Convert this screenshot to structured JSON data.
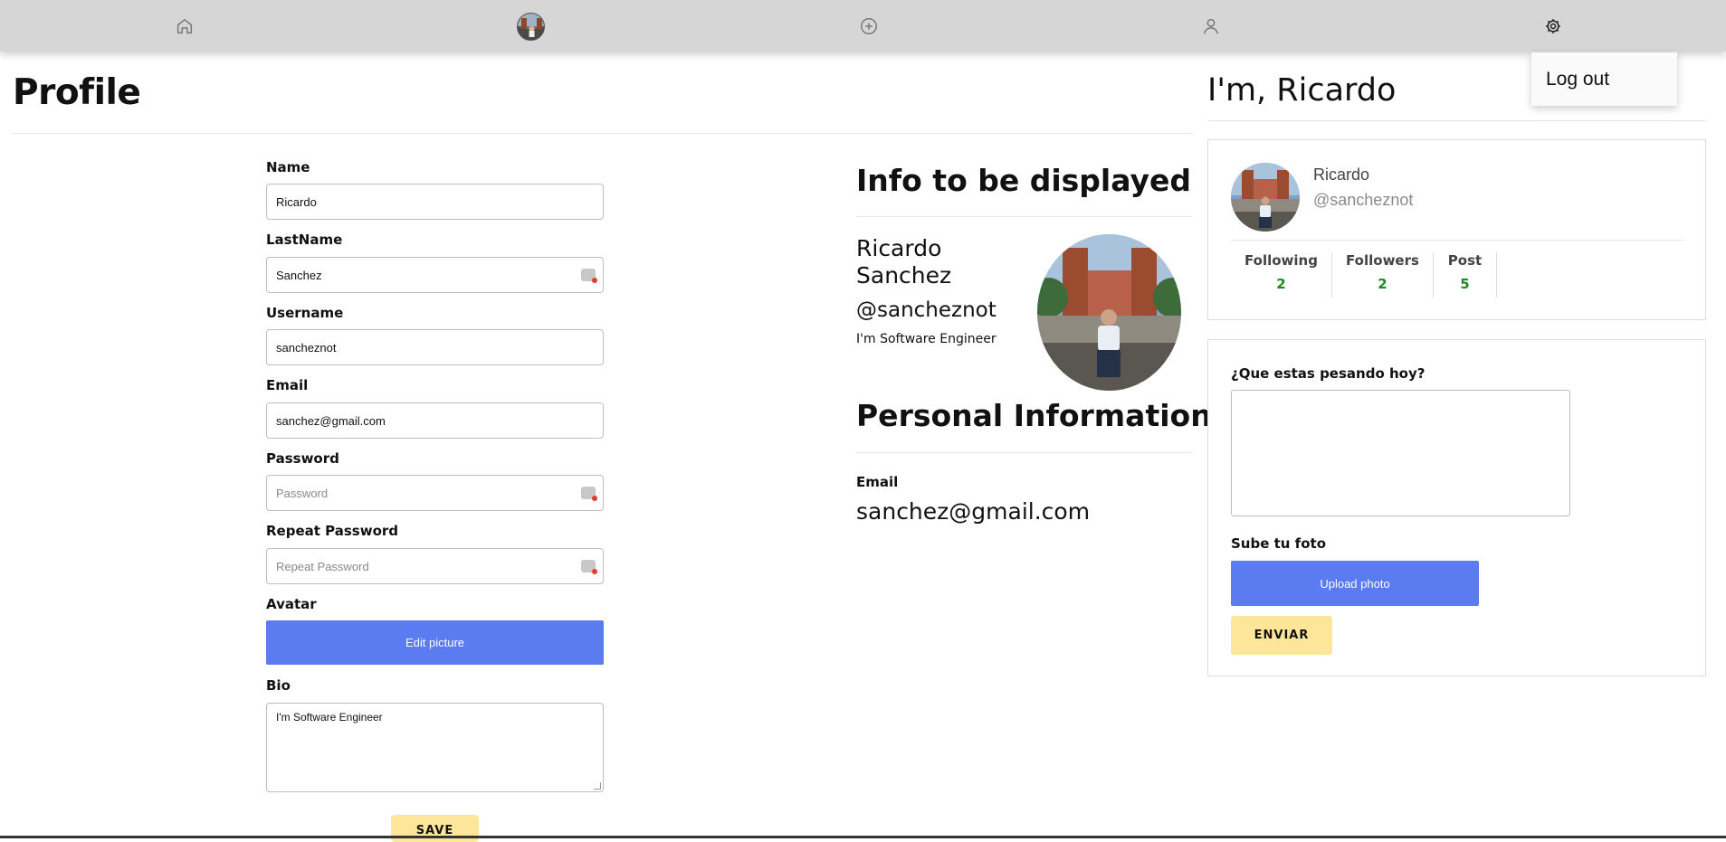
{
  "nav": {
    "items": [
      {
        "icon": "home-icon"
      },
      {
        "icon": "avatar"
      },
      {
        "icon": "add-circle-icon"
      },
      {
        "icon": "user-icon"
      },
      {
        "icon": "gear-icon"
      }
    ],
    "dropdown": {
      "logout_label": "Log out"
    }
  },
  "profile": {
    "title": "Profile",
    "form": {
      "name_label": "Name",
      "name_value": "Ricardo",
      "lastname_label": "LastName",
      "lastname_value": "Sanchez",
      "username_label": "Username",
      "username_value": "sancheznot",
      "email_label": "Email",
      "email_value": "sanchez@gmail.com",
      "password_label": "Password",
      "password_placeholder": "Password",
      "repeat_password_label": "Repeat Password",
      "repeat_password_placeholder": "Repeat Password",
      "avatar_label": "Avatar",
      "edit_picture_label": "Edit picture",
      "bio_label": "Bio",
      "bio_value": "I'm Software Engineer",
      "save_label": "SAVE"
    }
  },
  "info": {
    "title": "Info to be displayed",
    "name": "Ricardo Sanchez",
    "username": "@sancheznot",
    "bio": "I'm Software Engineer",
    "personal_title": "Personal Information",
    "email_label": "Email",
    "email_value": "sanchez@gmail.com"
  },
  "sidebar": {
    "greeting": "I'm, Ricardo",
    "card": {
      "name": "Ricardo",
      "handle": "@sancheznot",
      "stats": [
        {
          "label": "Following",
          "value": "2"
        },
        {
          "label": "Followers",
          "value": "2"
        },
        {
          "label": "Post",
          "value": "5"
        }
      ]
    },
    "post": {
      "prompt": "¿Que estas pesando hoy?",
      "photo_label": "Sube tu foto",
      "upload_label": "Upload photo",
      "submit_label": "ENVIAR"
    }
  },
  "colors": {
    "navbar_bg": "#d6d6d6",
    "primary_button": "#5b7cf0",
    "secondary_button": "#fde69a",
    "stat_value": "#1f8a1f"
  }
}
